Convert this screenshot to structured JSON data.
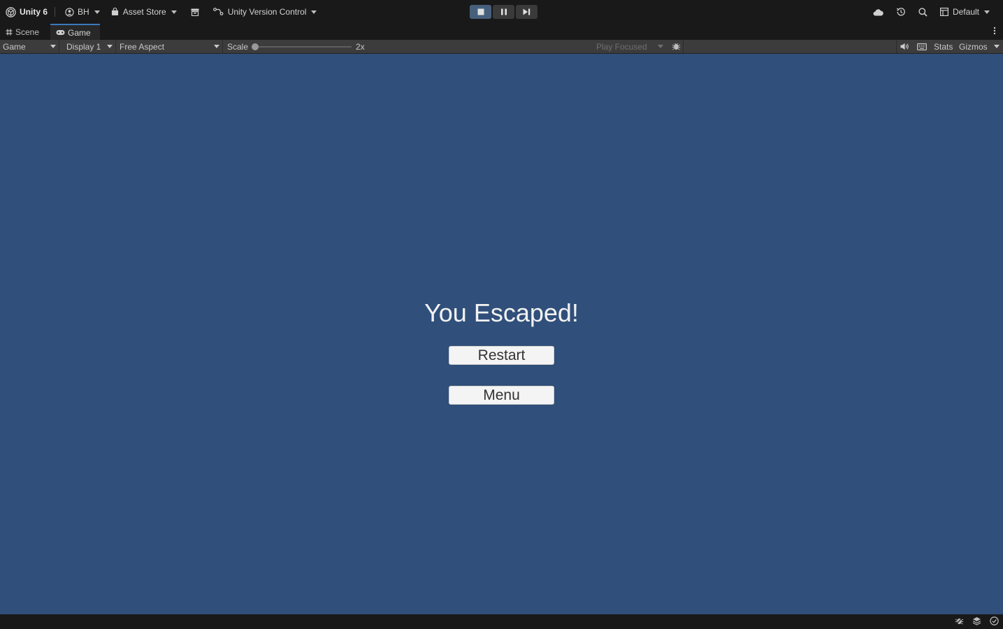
{
  "toolbar": {
    "unity_label": "Unity 6",
    "account_label": "BH",
    "asset_store_label": "Asset Store",
    "version_control_label": "Unity Version Control",
    "layout_label": "Default"
  },
  "tabs": [
    {
      "label": "Scene"
    },
    {
      "label": "Game"
    }
  ],
  "game_toolbar": {
    "view_mode": "Game",
    "display": "Display 1",
    "aspect": "Free Aspect",
    "scale_label": "Scale",
    "scale_value": "2x",
    "play_mode": "Play Focused",
    "stats_label": "Stats",
    "gizmos_label": "Gizmos"
  },
  "game": {
    "title": "You Escaped!",
    "restart_label": "Restart",
    "menu_label": "Menu",
    "background_color": "#304f7a"
  },
  "colors": {
    "accent": "#3a79bb",
    "play_active": "#46607c"
  }
}
